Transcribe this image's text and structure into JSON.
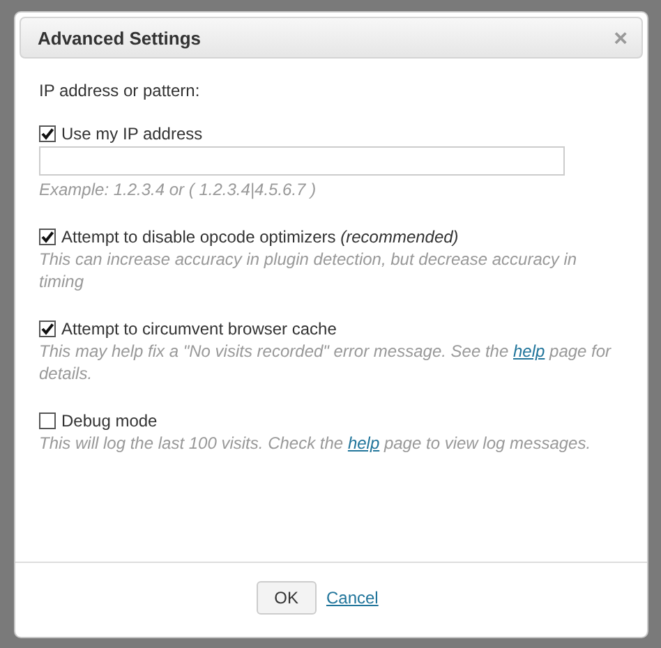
{
  "dialog": {
    "title": "Advanced Settings",
    "close": "×"
  },
  "ip_label": "IP address or pattern:",
  "options": [
    {
      "kind": "ip",
      "label": "Use my IP address",
      "checked": true,
      "hint": "Example: 1.2.3.4 or ( 1.2.3.4|4.5.6.7 )"
    },
    {
      "kind": "checkbox",
      "label": "Attempt to disable opcode optimizers *(recommended)*",
      "checked": true,
      "note": "This can increase accuracy in plugin detection, but decrease accuracy in timing"
    },
    {
      "kind": "checkbox",
      "label": "Attempt to circumvent browser cache",
      "checked": true,
      "note": "This may help fix a \"No visits recorded\" error message. See the",
      "link": "help",
      "note_end": "page for details."
    },
    {
      "kind": "checkbox",
      "label": "Debug mode",
      "checked": false,
      "note": "This will log the last 100 visits. Check the",
      "link": "help",
      "note_end": "page to view log messages."
    }
  ],
  "buttons": {
    "ok": "OK",
    "cancel": "Cancel"
  }
}
